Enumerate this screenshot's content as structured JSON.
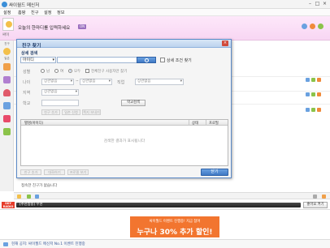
{
  "window": {
    "title": "싸이월드 메신저",
    "minimize": "–",
    "maximize": "□",
    "close": "×"
  },
  "menu": [
    "설정",
    "홈팡",
    "친구",
    "설정",
    "정보"
  ],
  "profile": {
    "name": "싸이",
    "message": "오늘의 한마디를 입력하세요",
    "status": "ON"
  },
  "sidebar": {
    "labels": [
      "친구",
      "일촌"
    ]
  },
  "dialog": {
    "title": "친구 찾기",
    "close": "×",
    "section": "상세 검색",
    "search_type": "아이디",
    "detail_search": "상세 조건 찾기",
    "gender": {
      "label": "성별",
      "options": [
        "남",
        "여",
        "모두"
      ]
    },
    "ex_contacts": "전체친구 사용자만 찾기",
    "age": {
      "label": "나이",
      "from": "상관없음",
      "sep": "~",
      "to": "상관없음"
    },
    "region": {
      "label": "지역",
      "value": "상관없음"
    },
    "job": {
      "label": "직업",
      "value": "상관없음"
    },
    "school": {
      "label": "학교",
      "button": "학교검색"
    },
    "add_buttons": [
      "친구 추가",
      "일촌 신청",
      "쪽지 보내기"
    ],
    "table": {
      "columns": [
        "별명(아이디)",
        "상태",
        "프로필"
      ],
      "empty": "검색한 결과가 표시됩니다"
    },
    "bottom_buttons": [
      "친구 추가",
      "대화하기",
      "프로필 보기"
    ],
    "ok": "닫기"
  },
  "bottom_status": "접속한 친구가 없습니다",
  "radio": {
    "logo": "SKY RADIO",
    "text": "[추천방송] 수현",
    "button": "좋아요 켜기"
  },
  "ad": {
    "top": "싸이월드 이벤트 진행중! 지금 참여",
    "main": "누구나 30% 추가 할인!"
  },
  "footer": "현재 공지: 싸이월드 메신저 No.1 이벤트 진행중",
  "colors": {
    "accent": "#3f78c4",
    "profile_bg": "#f8d6f3",
    "ad": "#f2752f",
    "radio_logo": "#e63c2a"
  }
}
